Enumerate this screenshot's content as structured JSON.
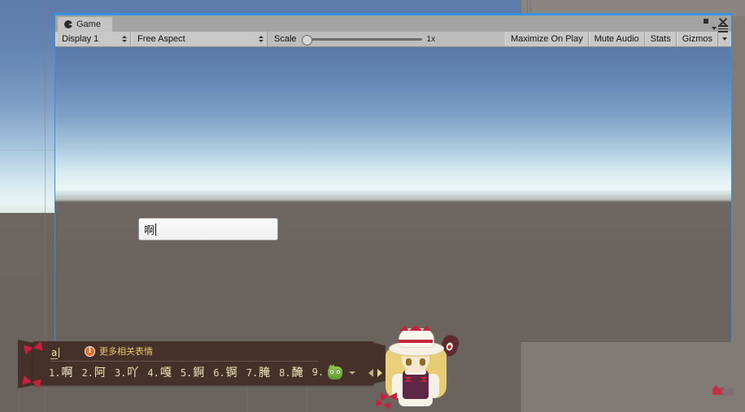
{
  "background": {
    "description": "unity-editor-scene-behind"
  },
  "game_window": {
    "tab": {
      "label": "Game",
      "icon": "pacman-icon"
    },
    "window_buttons": {
      "maximize": "maximize-icon",
      "close": "close-icon",
      "menu": "hamburger-menu-icon"
    },
    "toolbar": {
      "display": "Display 1",
      "aspect": "Free Aspect",
      "scale_label": "Scale",
      "scale_value": "1x",
      "scale_percent": 0,
      "maximize_on_play": "Maximize On Play",
      "mute_audio": "Mute Audio",
      "stats": "Stats",
      "gizmos": "Gizmos"
    },
    "view": {
      "input_value": "啊",
      "input_placeholder": ""
    }
  },
  "ime": {
    "composition": "a",
    "hint_icon": "i",
    "hint_text": "更多相关表情",
    "candidates": [
      {
        "num": "1.",
        "char": "啊"
      },
      {
        "num": "2.",
        "char": "阿"
      },
      {
        "num": "3.",
        "char": "吖"
      },
      {
        "num": "4.",
        "char": "嘎"
      },
      {
        "num": "5.",
        "char": "錒"
      },
      {
        "num": "6.",
        "char": "锕"
      },
      {
        "num": "7.",
        "char": "腌"
      },
      {
        "num": "8.",
        "char": "醃"
      },
      {
        "num": "9.",
        "char": ""
      }
    ],
    "controls": {
      "emoji": "emoji-face-icon",
      "emoji_more": "chevron-down-icon",
      "prev": "prev-page-arrow-icon",
      "next": "next-page-arrow-icon",
      "dropdown": "dropdown-icon"
    }
  },
  "mascot": {
    "name": "anime-character-overlay"
  }
}
